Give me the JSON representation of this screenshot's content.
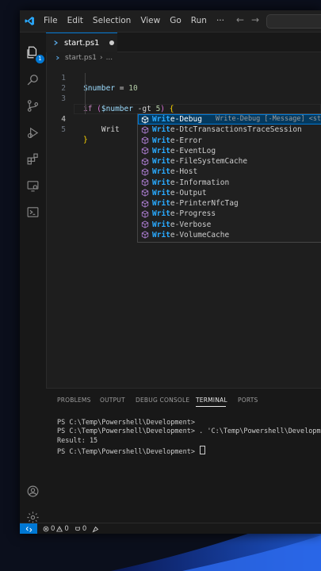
{
  "colors": {
    "accent": "#0078d4",
    "editor_bg": "#1e1e1e",
    "match": "#2aaaff"
  },
  "titlebar": {
    "menus": [
      "File",
      "Edit",
      "Selection",
      "View",
      "Go",
      "Run"
    ],
    "more": "···",
    "back": "←",
    "forward": "→"
  },
  "activity": {
    "explorer_badge": "1"
  },
  "tab": {
    "label": "start.ps1"
  },
  "breadcrumb": {
    "file": "start.ps1",
    "sep": "›",
    "more": "..."
  },
  "editor": {
    "line_numbers": [
      "1",
      "2",
      "3",
      "4",
      "5"
    ],
    "l1_var": "$number",
    "l1_op": " = ",
    "l1_num": "10",
    "l3_kw": "if",
    "l3_paren_open": " (",
    "l3_var": "$number",
    "l3_op": " -gt ",
    "l3_num": "5",
    "l3_paren_close": ")",
    "l3_brace": " {",
    "l4_text": "    Writ",
    "l5_brace": "}"
  },
  "suggestions": {
    "match": "Writ",
    "items": [
      {
        "rest": "e-Debug",
        "detail": "Write-Debug [-Message] <string> [<C"
      },
      {
        "rest": "e-DtcTransactionsTraceSession"
      },
      {
        "rest": "e-Error"
      },
      {
        "rest": "e-EventLog"
      },
      {
        "rest": "e-FileSystemCache"
      },
      {
        "rest": "e-Host"
      },
      {
        "rest": "e-Information"
      },
      {
        "rest": "e-Output"
      },
      {
        "rest": "e-PrinterNfcTag"
      },
      {
        "rest": "e-Progress"
      },
      {
        "rest": "e-Verbose"
      },
      {
        "rest": "e-VolumeCache"
      }
    ]
  },
  "panel": {
    "tabs": [
      "PROBLEMS",
      "OUTPUT",
      "DEBUG CONSOLE",
      "TERMINAL",
      "PORTS"
    ],
    "terminal_lines": [
      "PS C:\\Temp\\Powershell\\Development>",
      "PS C:\\Temp\\Powershell\\Development> . 'C:\\Temp\\Powershell\\Development'",
      "Result: 15",
      "PS C:\\Temp\\Powershell\\Development> "
    ]
  },
  "status": {
    "errors": "0",
    "warnings": "0",
    "ports": "0"
  }
}
